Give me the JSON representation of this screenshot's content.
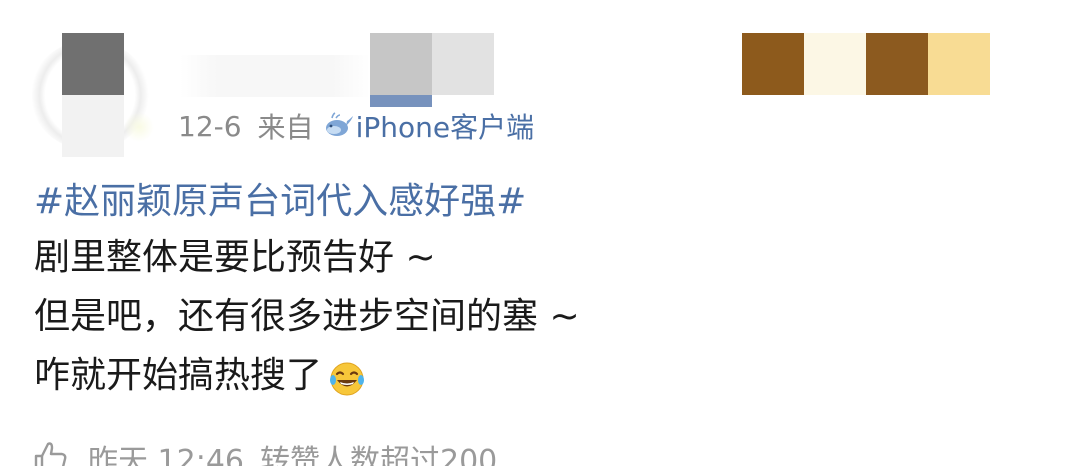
{
  "post": {
    "date": "12-6",
    "from_label": "来自",
    "source_client": "iPhone客户端",
    "topic": "#赵丽颖原声台词代入感好强#",
    "body_lines": [
      "剧里整体是要比预告好 ~",
      "但是吧，还有很多进步空间的塞 ~",
      "咋就开始搞热搜了"
    ],
    "emoji": "laugh-cry-emoji"
  },
  "footer": {
    "time": "昨天 12:46",
    "note": "转赞人数超过200"
  },
  "colors": {
    "link": "#4a6fa5",
    "meta": "#8a8a8a",
    "body": "#1a1a1a"
  }
}
